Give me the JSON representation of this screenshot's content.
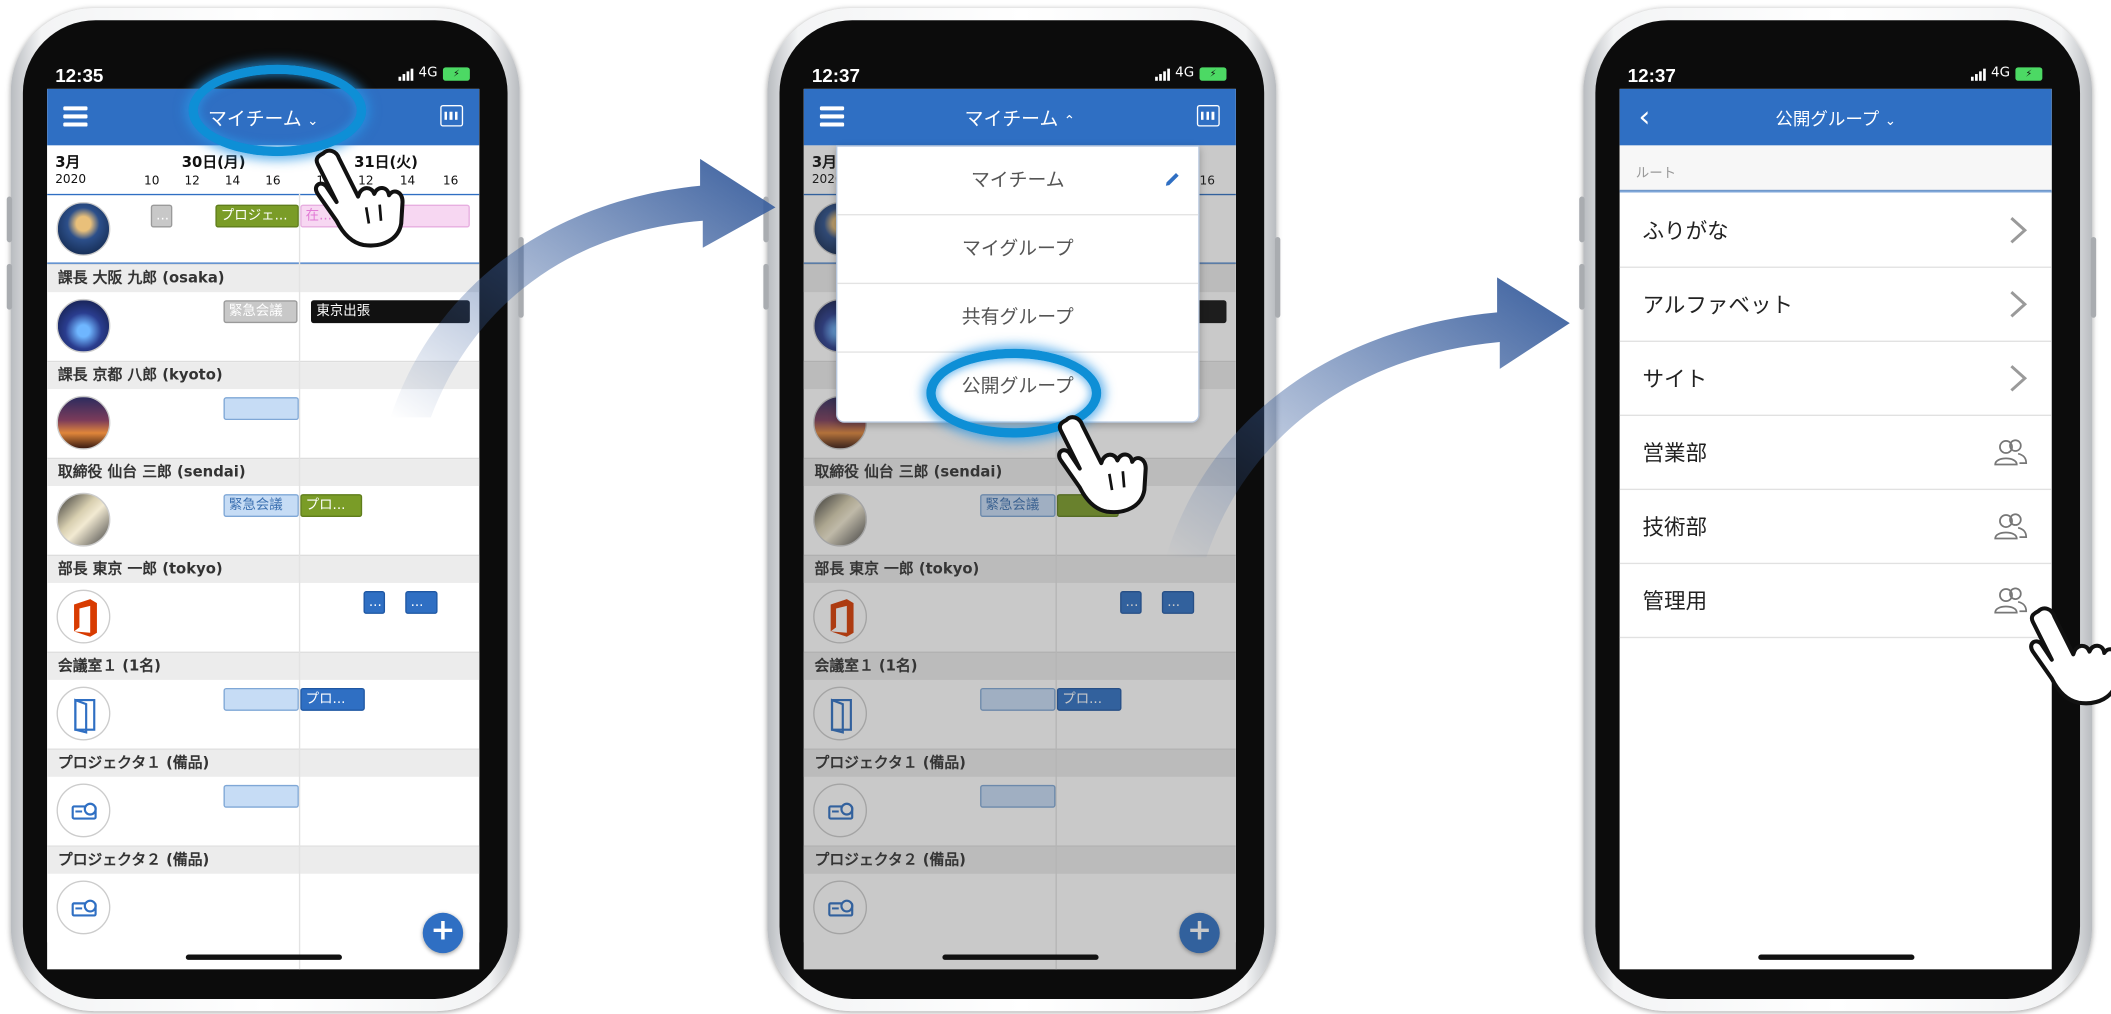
{
  "phone1": {
    "time": "12:35",
    "network": "4G",
    "nav_title": "マイチーム",
    "dates": {
      "month": "3月",
      "year": "2020",
      "day1": "30日(月)",
      "day2": "31日(火)",
      "hours": [
        "10",
        "12",
        "14",
        "16",
        "10",
        "12",
        "14",
        "16"
      ]
    },
    "rows": [
      {
        "label": "",
        "events": [
          "...",
          "プロジェ...",
          "在..."
        ]
      },
      {
        "label": "課長 大阪 九郎 (osaka)",
        "events": [
          "緊急会議",
          "東京出張"
        ]
      },
      {
        "label": "課長 京都 八郎 (kyoto)",
        "events": [
          ""
        ]
      },
      {
        "label": "取締役 仙台 三郎 (sendai)",
        "events": [
          "緊急会議",
          "プロ..."
        ]
      },
      {
        "label": "部長 東京 一郎 (tokyo)",
        "events": [
          "...",
          "..."
        ]
      },
      {
        "label": "会議室１ (1名)",
        "events": [
          "",
          "プロ..."
        ]
      },
      {
        "label": "プロジェクタ１ (備品)",
        "events": [
          ""
        ]
      },
      {
        "label": "プロジェクタ２ (備品)",
        "events": []
      }
    ]
  },
  "phone2": {
    "time": "12:37",
    "network": "4G",
    "nav_title": "マイチーム",
    "menu": [
      "マイチーム",
      "マイグループ",
      "共有グループ",
      "公開グループ"
    ]
  },
  "phone3": {
    "time": "12:37",
    "network": "4G",
    "nav_title": "公開グループ",
    "root_label": "ルート",
    "items": [
      {
        "label": "ふりがな",
        "type": "folder"
      },
      {
        "label": "アルファベット",
        "type": "folder"
      },
      {
        "label": "サイト",
        "type": "folder"
      },
      {
        "label": "営業部",
        "type": "group"
      },
      {
        "label": "技術部",
        "type": "group"
      },
      {
        "label": "管理用",
        "type": "group"
      }
    ]
  },
  "colors": {
    "nav_blue": "#2f6fc3",
    "highlight_ring": "#0e8fd6",
    "arrow": "#3a5f9e"
  }
}
